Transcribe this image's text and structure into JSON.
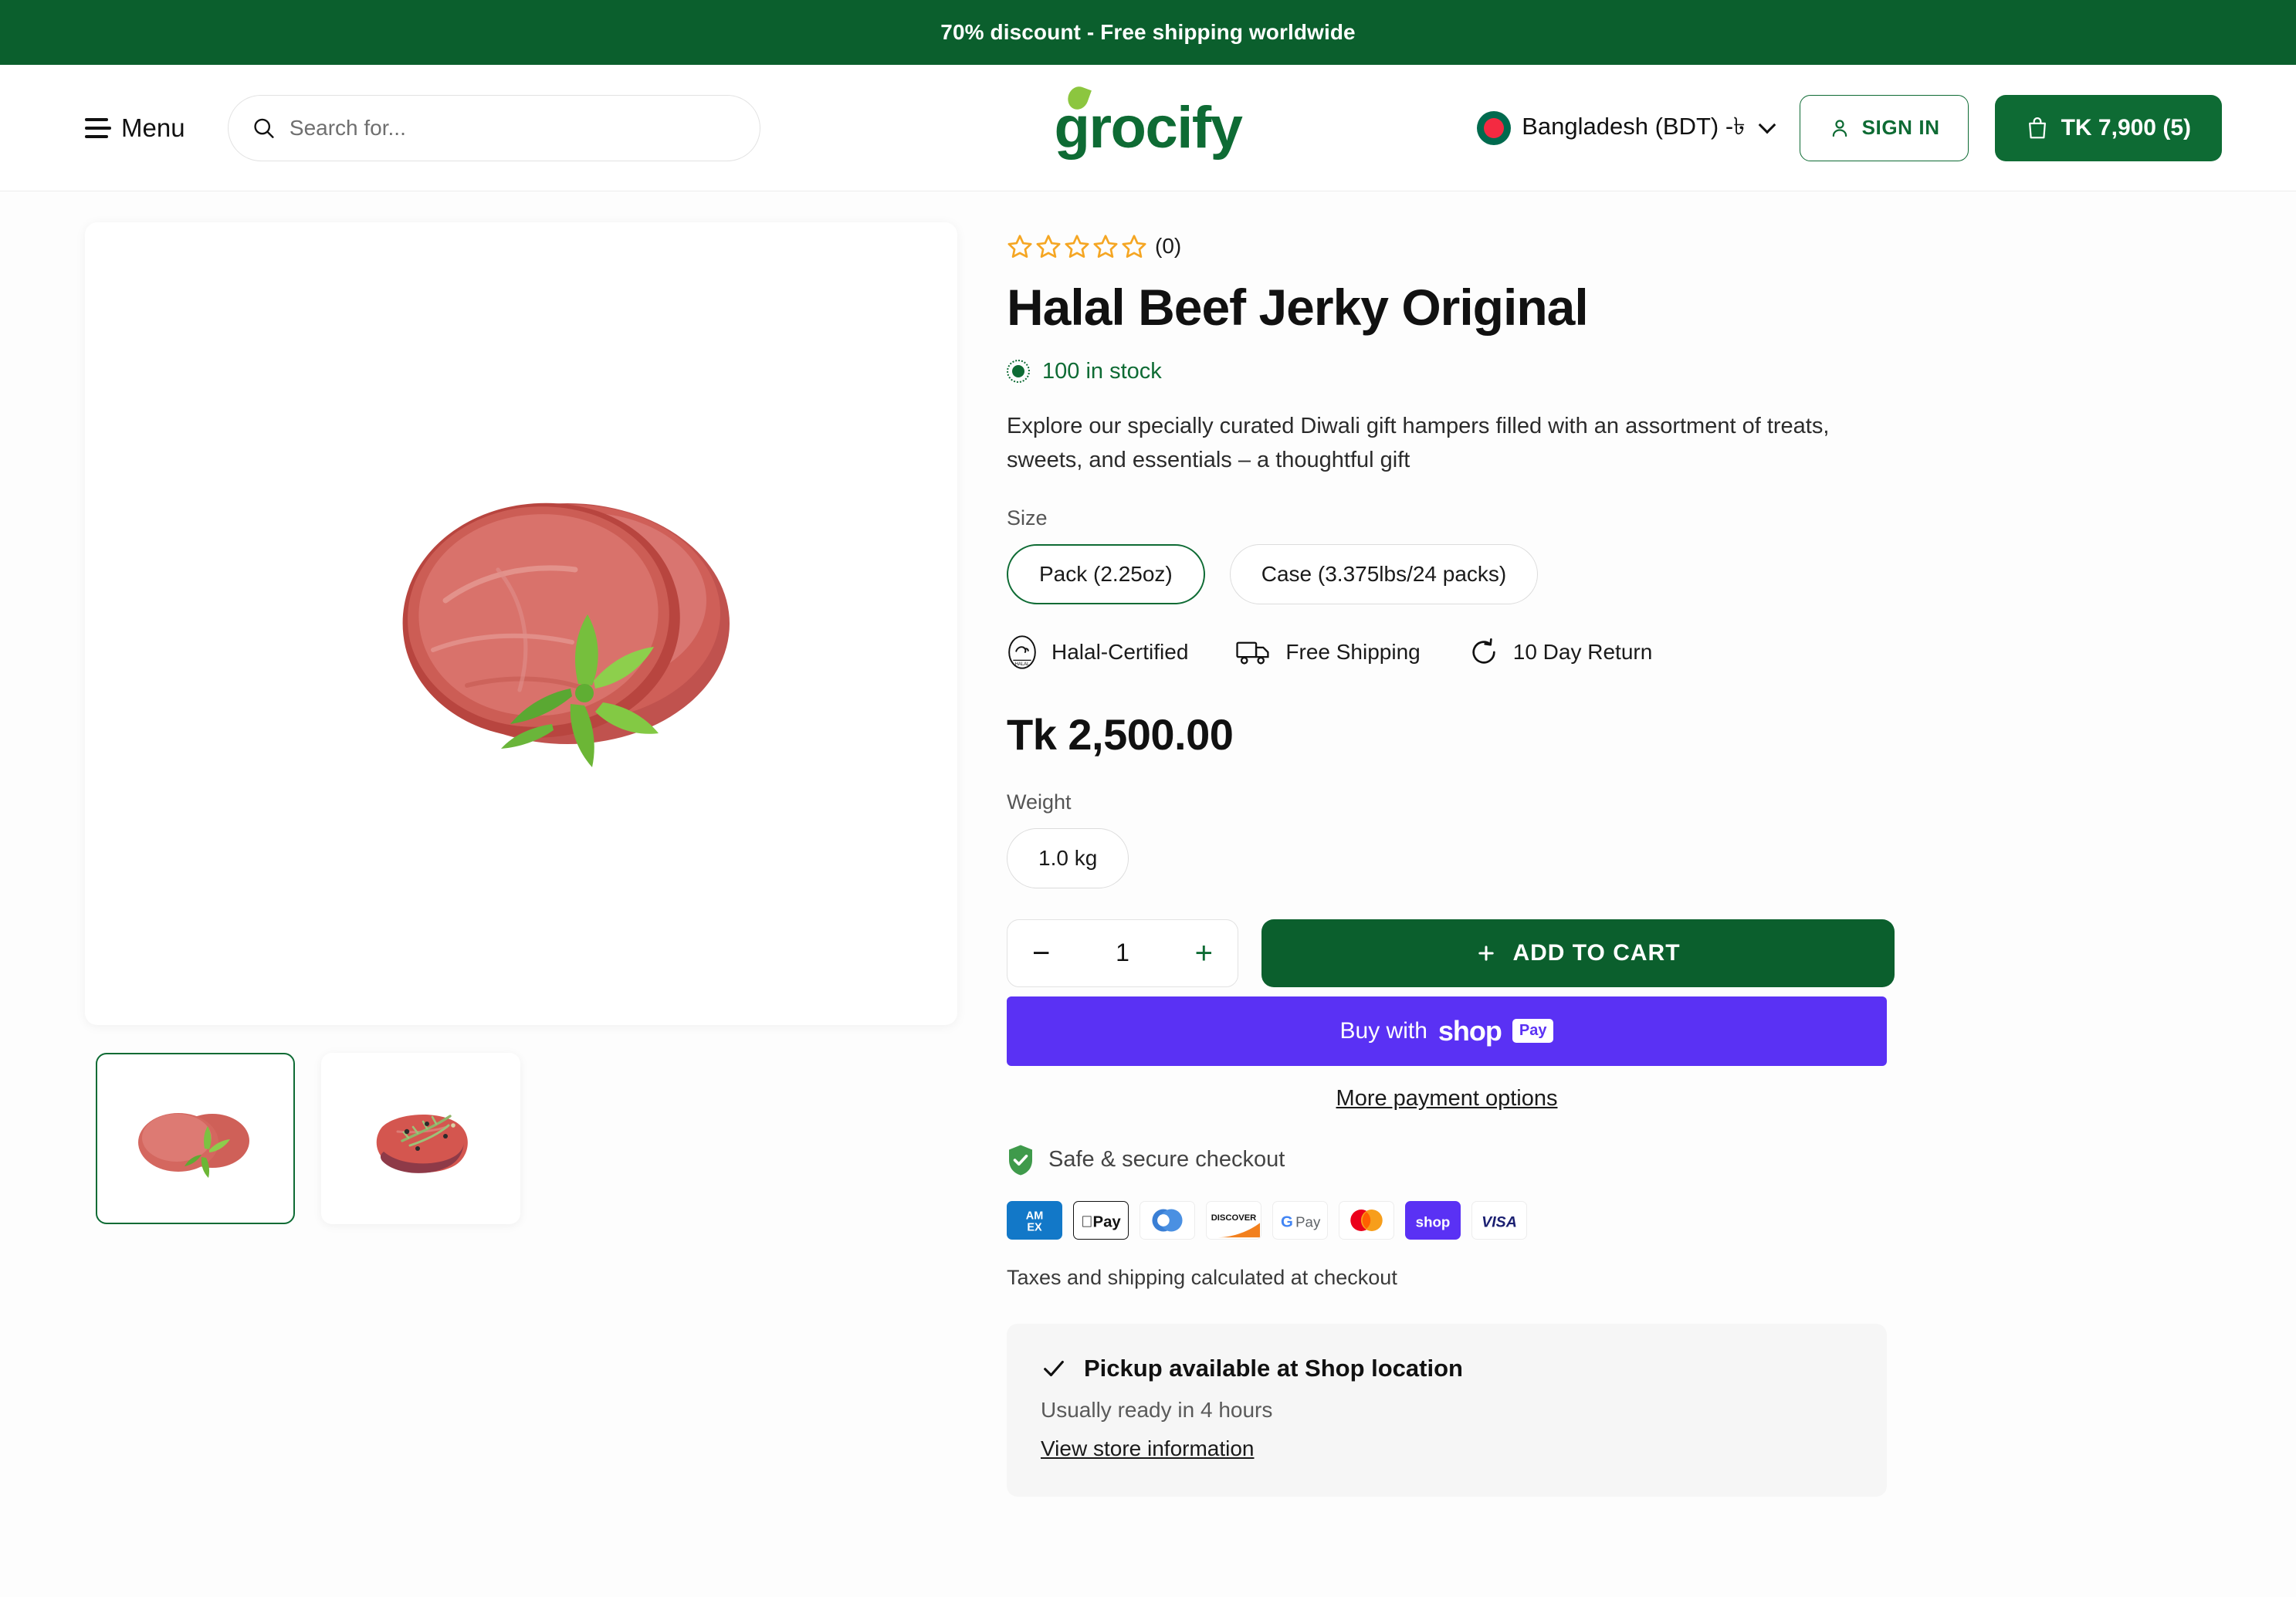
{
  "announcement": {
    "text": "70% discount - Free shipping worldwide"
  },
  "header": {
    "menu_label": "Menu",
    "search_placeholder": "Search for...",
    "logo_text": "grocify",
    "country_label": "Bangladesh (BDT) -৳",
    "signin_label": "SIGN IN",
    "cart_label": "TK 7,900 (5)",
    "icons": {
      "menu": "hamburger-icon",
      "search": "search-icon",
      "chevron": "chevron-down-icon",
      "user": "user-icon",
      "bag": "shopping-bag-icon"
    }
  },
  "gallery": {
    "main_alt": "Raw beef steaks with parsley garnish",
    "thumbnails": [
      {
        "alt": "Beef cuts with parsley",
        "active": true
      },
      {
        "alt": "Beef steak with rosemary and peppercorns",
        "active": false
      }
    ]
  },
  "product": {
    "rating_stars": 5,
    "rating_filled": 0,
    "review_count": "(0)",
    "title": "Halal Beef Jerky Original",
    "stock_label": "100 in stock",
    "description": "Explore our specially curated Diwali gift hampers filled with an assortment of treats, sweets, and essentials – a thoughtful gift",
    "size_label": "Size",
    "size_options": [
      {
        "label": "Pack (2.25oz)",
        "selected": true
      },
      {
        "label": "Case (3.375lbs/24 packs)",
        "selected": false
      }
    ],
    "badges": [
      {
        "label": "Halal-Certified",
        "icon": "halal-seal-icon"
      },
      {
        "label": "Free Shipping",
        "icon": "truck-icon"
      },
      {
        "label": "10 Day Return",
        "icon": "return-arrow-icon"
      }
    ],
    "price": "Tk 2,500.00",
    "weight_label": "Weight",
    "weight_options": [
      {
        "label": "1.0 kg",
        "selected": false
      }
    ],
    "quantity": "1",
    "qty_minus": "−",
    "qty_plus": "+",
    "add_to_cart_label": "ADD TO CART",
    "shop_pay": {
      "prefix": "Buy with",
      "logo": "shop",
      "badge": "Pay"
    },
    "more_payment_options": "More payment options",
    "secure_label": "Safe & secure checkout",
    "payment_methods": [
      "American Express",
      "Apple Pay",
      "Diners Club",
      "Discover",
      "Google Pay",
      "Mastercard",
      "Shop Pay",
      "Visa"
    ],
    "tax_note": "Taxes and shipping calculated at checkout",
    "pickup": {
      "title": "Pickup available at Shop location",
      "subtitle": "Usually ready in 4 hours",
      "link": "View store information"
    }
  },
  "colors": {
    "brand_green": "#0e6b34",
    "announce_green": "#0b5f2d",
    "star_amber": "#f5a623",
    "shop_purple": "#5a31f4"
  }
}
